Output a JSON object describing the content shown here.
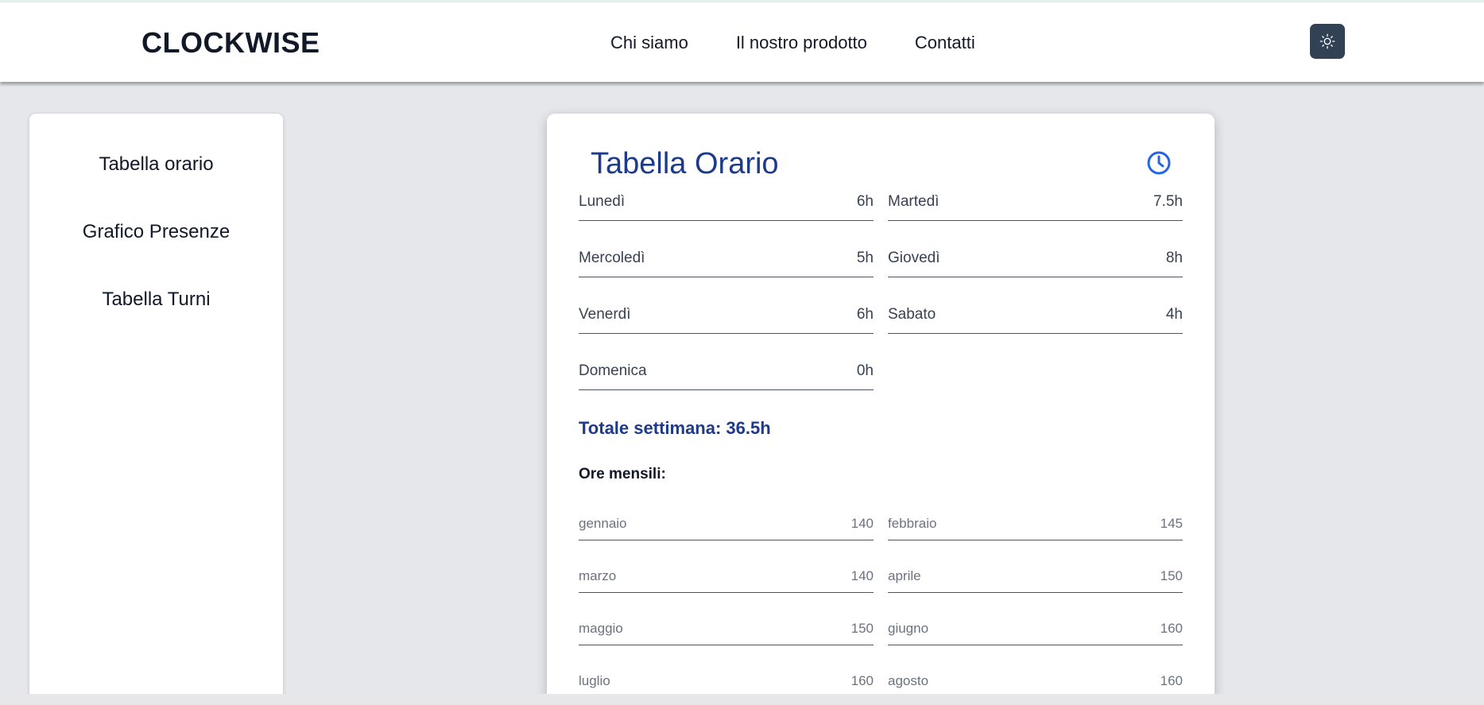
{
  "header": {
    "brand": "CLOCKWISE",
    "nav": [
      "Chi siamo",
      "Il nostro prodotto",
      "Contatti"
    ]
  },
  "sidebar": {
    "items": [
      "Tabella orario",
      "Grafico Presenze",
      "Tabella Turni"
    ]
  },
  "main": {
    "title": "Tabella Orario",
    "days": [
      {
        "label": "Lunedì",
        "value": "6h"
      },
      {
        "label": "Martedì",
        "value": "7.5h"
      },
      {
        "label": "Mercoledì",
        "value": "5h"
      },
      {
        "label": "Giovedì",
        "value": "8h"
      },
      {
        "label": "Venerdì",
        "value": "6h"
      },
      {
        "label": "Sabato",
        "value": "4h"
      },
      {
        "label": "Domenica",
        "value": "0h"
      }
    ],
    "total": "Totale settimana: 36.5h",
    "monthly_title": "Ore mensili:",
    "months": [
      {
        "label": "gennaio",
        "value": "140"
      },
      {
        "label": "febbraio",
        "value": "145"
      },
      {
        "label": "marzo",
        "value": "140"
      },
      {
        "label": "aprile",
        "value": "150"
      },
      {
        "label": "maggio",
        "value": "150"
      },
      {
        "label": "giugno",
        "value": "160"
      },
      {
        "label": "luglio",
        "value": "160"
      },
      {
        "label": "agosto",
        "value": "160"
      }
    ]
  },
  "icons": {
    "theme": "sun-icon",
    "title": "clock-icon"
  },
  "colors": {
    "accent": "#1e3a8a",
    "clock": "#2563eb",
    "theme_button": "#334155",
    "background": "#e5e7eb"
  }
}
